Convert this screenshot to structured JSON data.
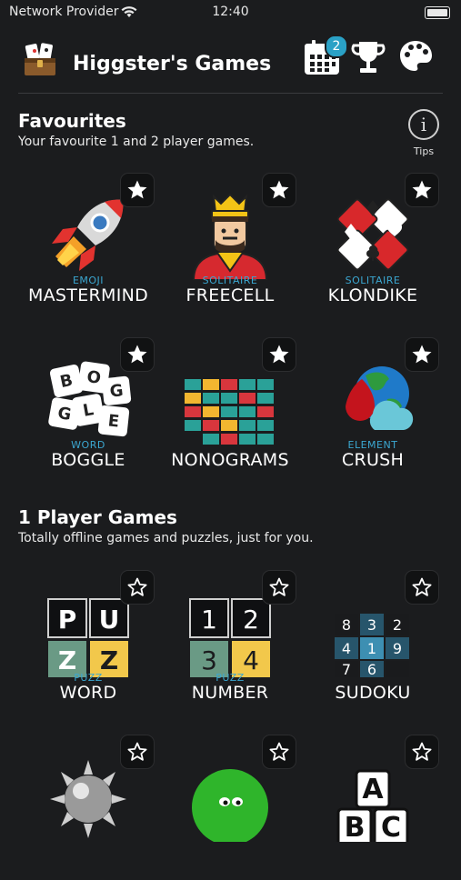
{
  "status": {
    "provider": "Network Provider",
    "time": "12:40"
  },
  "header": {
    "title": "Higgster's Games",
    "calendar_badge": "2",
    "icons": [
      "treasure-chest-logo-icon",
      "calendar-icon",
      "trophy-icon",
      "palette-icon"
    ]
  },
  "favourites": {
    "title": "Favourites",
    "subtitle": "Your favourite 1 and 2 player games.",
    "tips_label": "Tips",
    "games": [
      {
        "small": "EMOJI",
        "name": "MASTERMIND",
        "icon": "rocket-icon"
      },
      {
        "small": "SOLITAIRE",
        "name": "FREECELL",
        "icon": "king-icon"
      },
      {
        "small": "SOLITAIRE",
        "name": "KLONDIKE",
        "icon": "card-suits-icon"
      },
      {
        "small": "WORD",
        "name": "BOGGLE",
        "icon": "letter-dice-icon"
      },
      {
        "small": "",
        "name": "NONOGRAMS",
        "icon": "grid-puzzle-icon"
      },
      {
        "small": "ELEMENT",
        "name": "CRUSH",
        "icon": "earth-water-icon"
      }
    ]
  },
  "one_player": {
    "title": "1 Player Games",
    "subtitle": "Totally offline games and puzzles, just for you.",
    "games": [
      {
        "small": "PUZZ",
        "name": "WORD",
        "icon": "puzz-word-icon"
      },
      {
        "small": "PUZZ",
        "name": "NUMBER",
        "icon": "puzz-number-icon"
      },
      {
        "small": "",
        "name": "SUDOKU",
        "icon": "sudoku-grid-icon"
      },
      {
        "small": "",
        "name": "",
        "icon": "mine-icon"
      },
      {
        "small": "",
        "name": "",
        "icon": "green-blob-icon"
      },
      {
        "small": "",
        "name": "",
        "icon": "abc-blocks-icon"
      }
    ],
    "puzz_word_letters": [
      "P",
      "U",
      "Z",
      "Z"
    ],
    "puzz_number_digits": [
      "1",
      "2",
      "3",
      "4"
    ],
    "sudoku_cells": [
      "8",
      "3",
      "2",
      "4",
      "1",
      "9",
      "7",
      "6",
      ""
    ],
    "abc_letters": [
      "A",
      "B",
      "C"
    ]
  },
  "colors": {
    "background": "#1b1c1e",
    "accent": "#3ba7d1",
    "badge": "#2aa1c6",
    "yellow": "#f2c84b",
    "green_tile": "#6a9a85"
  }
}
